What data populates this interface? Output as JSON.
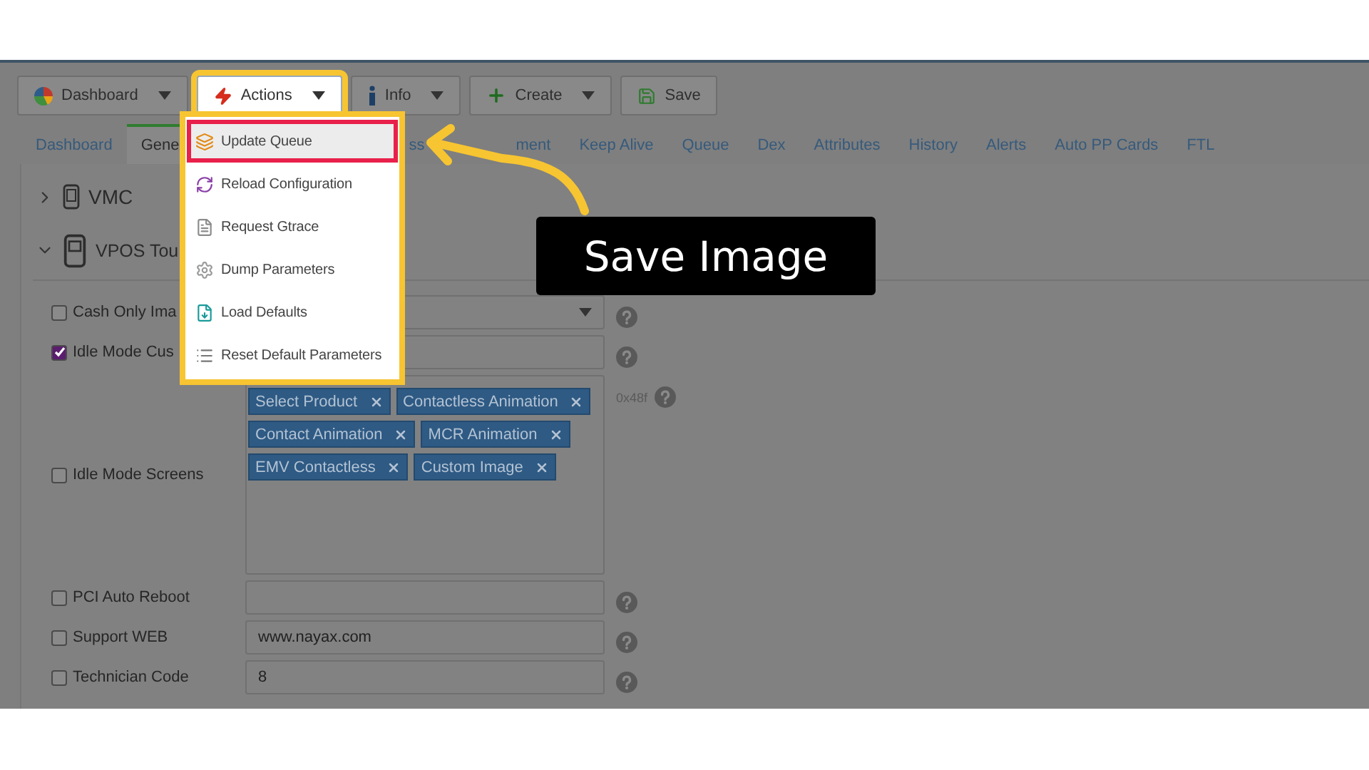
{
  "toolbar": [
    {
      "label": "Dashboard",
      "kind": "dropdown",
      "open": false
    },
    {
      "label": "Actions",
      "kind": "dropdown",
      "open": true
    },
    {
      "label": "Info",
      "kind": "dropdown",
      "open": false
    },
    {
      "label": "Create",
      "kind": "dropdown",
      "open": false
    },
    {
      "label": "Save",
      "kind": "button",
      "open": false
    }
  ],
  "actions_menu": [
    {
      "label": "Update Queue",
      "selected": true
    },
    {
      "label": "Reload Configuration",
      "selected": false
    },
    {
      "label": "Request Gtrace",
      "selected": false
    },
    {
      "label": "Dump Parameters",
      "selected": false
    },
    {
      "label": "Load Defaults",
      "selected": false
    },
    {
      "label": "Reset Default Parameters",
      "selected": false
    }
  ],
  "tabs": [
    {
      "label": "Dashboard",
      "selected": false
    },
    {
      "label": "Gene",
      "selected": true
    },
    {
      "label": "ss",
      "selected": false
    },
    {
      "label": "ment",
      "selected": false
    },
    {
      "label": "Keep Alive",
      "selected": false
    },
    {
      "label": "Queue",
      "selected": false
    },
    {
      "label": "Dex",
      "selected": false
    },
    {
      "label": "Attributes",
      "selected": false
    },
    {
      "label": "History",
      "selected": false
    },
    {
      "label": "Alerts",
      "selected": false
    },
    {
      "label": "Auto PP Cards",
      "selected": false
    },
    {
      "label": "FTL",
      "selected": false
    }
  ],
  "sections": [
    {
      "title": "VMC",
      "expanded": false
    },
    {
      "title": "VPOS Tou",
      "expanded": true
    }
  ],
  "fields": [
    {
      "label": "Cash Only Ima",
      "checked": false,
      "kind": "select"
    },
    {
      "label": "Idle Mode Cus",
      "checked": true,
      "kind": "text"
    },
    {
      "label": "Idle Mode Screens",
      "checked": false,
      "kind": "tags",
      "hint": "0x48f",
      "tags": [
        "Select Product",
        "Contactless Animation",
        "Contact Animation",
        "MCR Animation",
        "EMV Contactless",
        "Custom Image"
      ]
    },
    {
      "label": "PCI Auto Reboot",
      "checked": false,
      "kind": "text"
    },
    {
      "label": "Support WEB",
      "checked": false,
      "kind": "text",
      "value": "www.nayax.com"
    },
    {
      "label": "Technician Code",
      "checked": false,
      "kind": "text",
      "value": "8"
    }
  ],
  "callout": {
    "text": "Save Image"
  }
}
